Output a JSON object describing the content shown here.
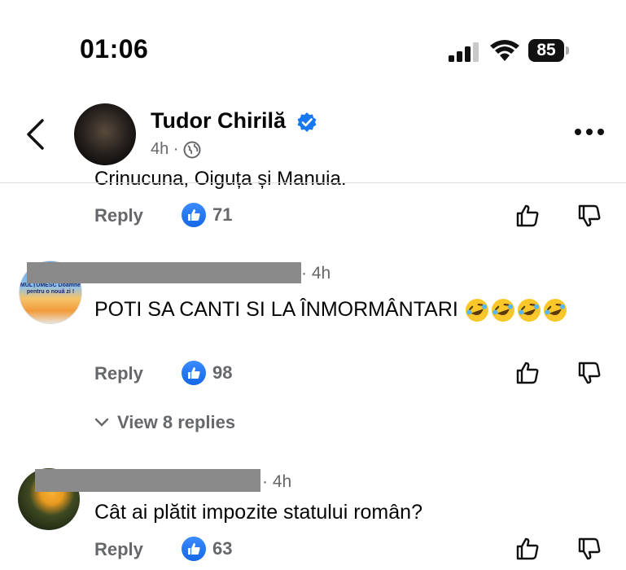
{
  "status_bar": {
    "time": "01:06",
    "battery": "85"
  },
  "header": {
    "author": "Tudor Chirilă",
    "age": "4h ·"
  },
  "comments": [
    {
      "text": "Crinucuna, Oiguța și Manuia.",
      "reply_label": "Reply",
      "likes": "71"
    },
    {
      "timestamp": "· 4h",
      "avatar_text": "MULȚUMESC Doamne pentru o nouă zi !",
      "text": "POTI SA CANTI SI LA ÎNMORMÂNTARI",
      "reply_label": "Reply",
      "likes": "98",
      "view_replies": "View 8 replies"
    },
    {
      "timestamp": "· 4h",
      "text": "Cât ai plătit impozite statului român?",
      "reply_label": "Reply",
      "likes": "63"
    }
  ],
  "colors": {
    "verified": "#1877f2",
    "like": "#1877f2",
    "secondary_text": "#65676b"
  }
}
